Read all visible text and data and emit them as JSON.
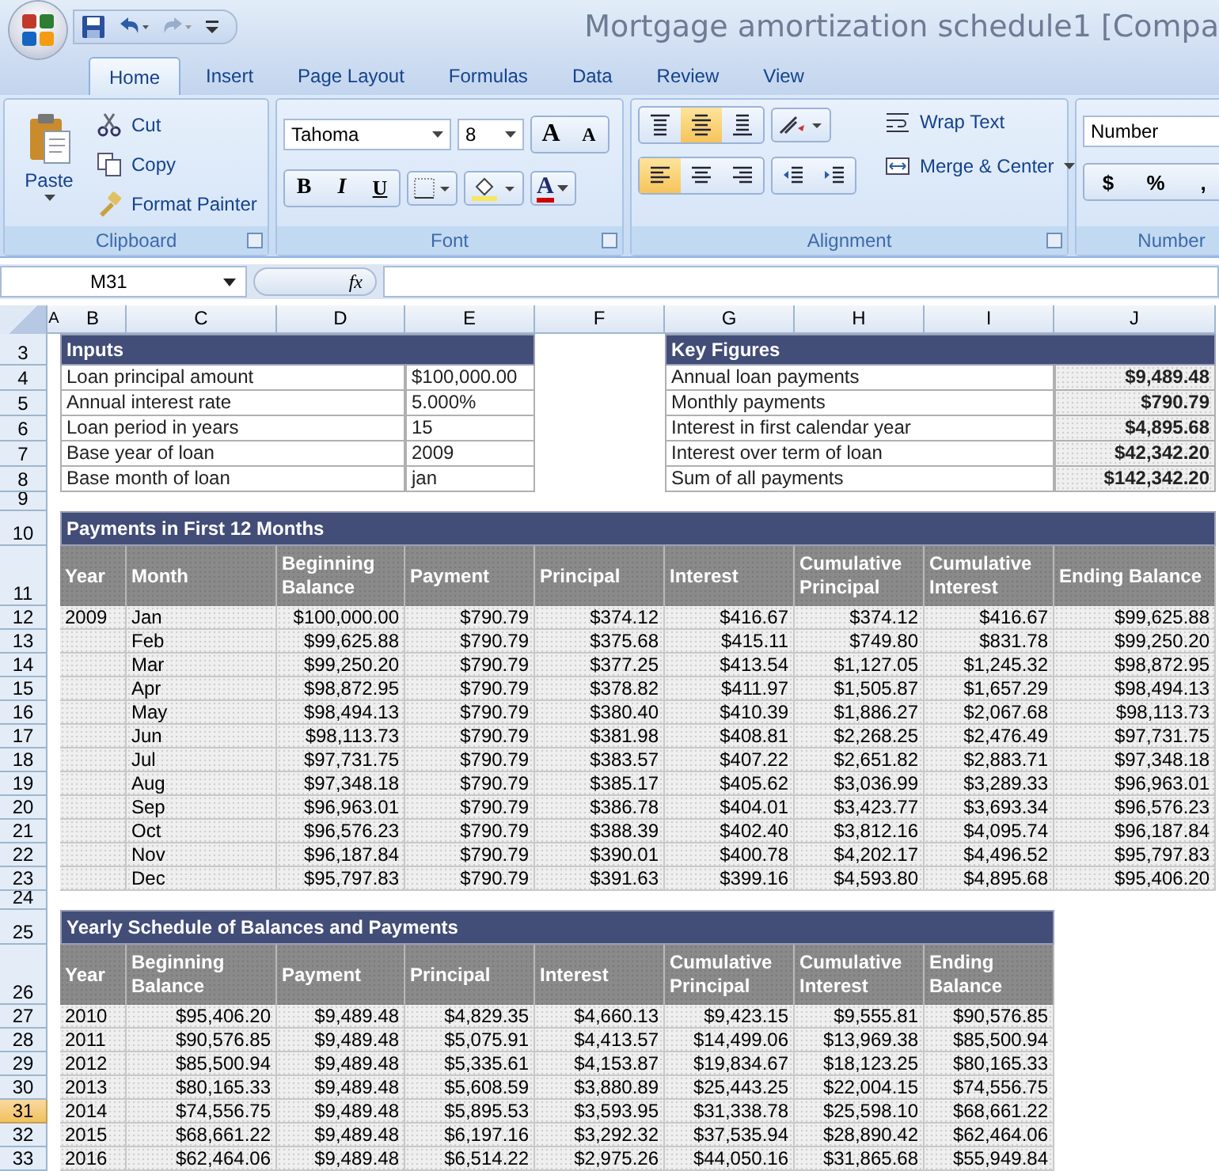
{
  "window": {
    "title": "Mortgage amortization schedule1  [Compa"
  },
  "tabs": [
    {
      "label": "Home",
      "selected": true
    },
    {
      "label": "Insert",
      "selected": false
    },
    {
      "label": "Page Layout",
      "selected": false
    },
    {
      "label": "Formulas",
      "selected": false
    },
    {
      "label": "Data",
      "selected": false
    },
    {
      "label": "Review",
      "selected": false
    },
    {
      "label": "View",
      "selected": false
    }
  ],
  "ribbon": {
    "clipboard": {
      "group": "Clipboard",
      "paste": "Paste",
      "items": [
        {
          "label": "Cut",
          "kind": "cut"
        },
        {
          "label": "Copy",
          "kind": "copy"
        },
        {
          "label": "Format Painter",
          "kind": "painter"
        }
      ]
    },
    "font": {
      "group": "Font",
      "name": "Tahoma",
      "size": "8",
      "grow": "A",
      "shrink": "A",
      "bold": "B",
      "italic": "I",
      "underline": "U",
      "color_letter": "A"
    },
    "alignment": {
      "group": "Alignment",
      "vertical": [
        {
          "kind": "top",
          "selected": false
        },
        {
          "kind": "middle",
          "selected": true
        },
        {
          "kind": "bottom",
          "selected": false
        }
      ],
      "horizontal": [
        {
          "kind": "left",
          "selected": true
        },
        {
          "kind": "center",
          "selected": false
        },
        {
          "kind": "right",
          "selected": false
        }
      ],
      "wrap": "Wrap Text",
      "merge": "Merge & Center"
    },
    "number": {
      "group": "Number",
      "format": "Number",
      "symbols": [
        "$",
        "%",
        ","
      ]
    }
  },
  "formula_bar": {
    "name_box": "M31",
    "fx": "fx"
  },
  "sheet": {
    "columns": [
      "A",
      "B",
      "C",
      "D",
      "E",
      "F",
      "G",
      "H",
      "I",
      "J"
    ],
    "rows": [
      {
        "kind": "titles",
        "number": "3",
        "selected": false,
        "left": "Inputs",
        "right": "Key Figures"
      },
      {
        "kind": "pair",
        "number": "4",
        "selected": false,
        "label": "Loan principal amount",
        "value": "$100,000.00",
        "key_label": "Annual loan payments",
        "key_value": "$9,489.48"
      },
      {
        "kind": "pair",
        "number": "5",
        "selected": false,
        "label": "Annual interest rate",
        "value": "5.000%",
        "key_label": "Monthly payments",
        "key_value": "$790.79"
      },
      {
        "kind": "pair",
        "number": "6",
        "selected": false,
        "label": "Loan period in years",
        "value": "15",
        "key_label": "Interest in first calendar year",
        "key_value": "$4,895.68"
      },
      {
        "kind": "pair",
        "number": "7",
        "selected": false,
        "label": "Base year of loan",
        "value": "2009",
        "key_label": "Interest over term of loan",
        "key_value": "$42,342.20"
      },
      {
        "kind": "pair",
        "number": "8",
        "selected": false,
        "label": "Base month of loan",
        "value": "jan",
        "key_label": "Sum of all payments",
        "key_value": "$142,342.20"
      },
      {
        "kind": "blank",
        "number": "9",
        "selected": false
      },
      {
        "kind": "band",
        "number": "10",
        "selected": false,
        "title": "Payments in First 12 Months"
      },
      {
        "kind": "header",
        "number": "11",
        "selected": false,
        "headings": [
          "Year",
          "Month",
          "Beginning Balance",
          "Payment",
          "Principal",
          "Interest",
          "Cumulative Principal",
          "Cumulative Interest",
          "Ending Balance"
        ]
      },
      {
        "kind": "data",
        "number": "12",
        "selected": false,
        "year": "2009",
        "month": "Jan",
        "amounts": [
          "$100,000.00",
          "$790.79",
          "$374.12",
          "$416.67",
          "$374.12",
          "$416.67",
          "$99,625.88"
        ]
      },
      {
        "kind": "data",
        "number": "13",
        "selected": false,
        "month": "Feb",
        "amounts": [
          "$99,625.88",
          "$790.79",
          "$375.68",
          "$415.11",
          "$749.80",
          "$831.78",
          "$99,250.20"
        ]
      },
      {
        "kind": "data",
        "number": "14",
        "selected": false,
        "month": "Mar",
        "amounts": [
          "$99,250.20",
          "$790.79",
          "$377.25",
          "$413.54",
          "$1,127.05",
          "$1,245.32",
          "$98,872.95"
        ]
      },
      {
        "kind": "data",
        "number": "15",
        "selected": false,
        "month": "Apr",
        "amounts": [
          "$98,872.95",
          "$790.79",
          "$378.82",
          "$411.97",
          "$1,505.87",
          "$1,657.29",
          "$98,494.13"
        ]
      },
      {
        "kind": "data",
        "number": "16",
        "selected": false,
        "month": "May",
        "amounts": [
          "$98,494.13",
          "$790.79",
          "$380.40",
          "$410.39",
          "$1,886.27",
          "$2,067.68",
          "$98,113.73"
        ]
      },
      {
        "kind": "data",
        "number": "17",
        "selected": false,
        "month": "Jun",
        "amounts": [
          "$98,113.73",
          "$790.79",
          "$381.98",
          "$408.81",
          "$2,268.25",
          "$2,476.49",
          "$97,731.75"
        ]
      },
      {
        "kind": "data",
        "number": "18",
        "selected": false,
        "month": "Jul",
        "amounts": [
          "$97,731.75",
          "$790.79",
          "$383.57",
          "$407.22",
          "$2,651.82",
          "$2,883.71",
          "$97,348.18"
        ]
      },
      {
        "kind": "data",
        "number": "19",
        "selected": false,
        "month": "Aug",
        "amounts": [
          "$97,348.18",
          "$790.79",
          "$385.17",
          "$405.62",
          "$3,036.99",
          "$3,289.33",
          "$96,963.01"
        ]
      },
      {
        "kind": "data",
        "number": "20",
        "selected": false,
        "month": "Sep",
        "amounts": [
          "$96,963.01",
          "$790.79",
          "$386.78",
          "$404.01",
          "$3,423.77",
          "$3,693.34",
          "$96,576.23"
        ]
      },
      {
        "kind": "data",
        "number": "21",
        "selected": false,
        "month": "Oct",
        "amounts": [
          "$96,576.23",
          "$790.79",
          "$388.39",
          "$402.40",
          "$3,812.16",
          "$4,095.74",
          "$96,187.84"
        ]
      },
      {
        "kind": "data",
        "number": "22",
        "selected": false,
        "month": "Nov",
        "amounts": [
          "$96,187.84",
          "$790.79",
          "$390.01",
          "$400.78",
          "$4,202.17",
          "$4,496.52",
          "$95,797.83"
        ]
      },
      {
        "kind": "data",
        "number": "23",
        "selected": false,
        "month": "Dec",
        "amounts": [
          "$95,797.83",
          "$790.79",
          "$391.63",
          "$399.16",
          "$4,593.80",
          "$4,895.68",
          "$95,406.20"
        ]
      },
      {
        "kind": "blank",
        "number": "24",
        "selected": false
      },
      {
        "kind": "band",
        "number": "25",
        "selected": false,
        "title": "Yearly Schedule of Balances and Payments"
      },
      {
        "kind": "header",
        "number": "26",
        "selected": false,
        "headings": [
          "Year",
          "Beginning Balance",
          "Payment",
          "Principal",
          "Interest",
          "Cumulative Principal",
          "Cumulative Interest",
          "Ending Balance"
        ]
      },
      {
        "kind": "data",
        "number": "27",
        "selected": false,
        "year": "2010",
        "amounts": [
          "$95,406.20",
          "$9,489.48",
          "$4,829.35",
          "$4,660.13",
          "$9,423.15",
          "$9,555.81",
          "$90,576.85"
        ]
      },
      {
        "kind": "data",
        "number": "28",
        "selected": false,
        "year": "2011",
        "amounts": [
          "$90,576.85",
          "$9,489.48",
          "$5,075.91",
          "$4,413.57",
          "$14,499.06",
          "$13,969.38",
          "$85,500.94"
        ]
      },
      {
        "kind": "data",
        "number": "29",
        "selected": false,
        "year": "2012",
        "amounts": [
          "$85,500.94",
          "$9,489.48",
          "$5,335.61",
          "$4,153.87",
          "$19,834.67",
          "$18,123.25",
          "$80,165.33"
        ]
      },
      {
        "kind": "data",
        "number": "30",
        "selected": false,
        "year": "2013",
        "amounts": [
          "$80,165.33",
          "$9,489.48",
          "$5,608.59",
          "$3,880.89",
          "$25,443.25",
          "$22,004.15",
          "$74,556.75"
        ]
      },
      {
        "kind": "data",
        "number": "31",
        "selected": true,
        "year": "2014",
        "amounts": [
          "$74,556.75",
          "$9,489.48",
          "$5,895.53",
          "$3,593.95",
          "$31,338.78",
          "$25,598.10",
          "$68,661.22"
        ]
      },
      {
        "kind": "data",
        "number": "32",
        "selected": false,
        "year": "2015",
        "amounts": [
          "$68,661.22",
          "$9,489.48",
          "$6,197.16",
          "$3,292.32",
          "$37,535.94",
          "$28,890.42",
          "$62,464.06"
        ]
      },
      {
        "kind": "data",
        "number": "33",
        "selected": false,
        "year": "2016",
        "amounts": [
          "$62,464.06",
          "$9,489.48",
          "$6,514.22",
          "$2,975.26",
          "$44,050.16",
          "$31,865.68",
          "$55,949.84"
        ]
      }
    ]
  }
}
